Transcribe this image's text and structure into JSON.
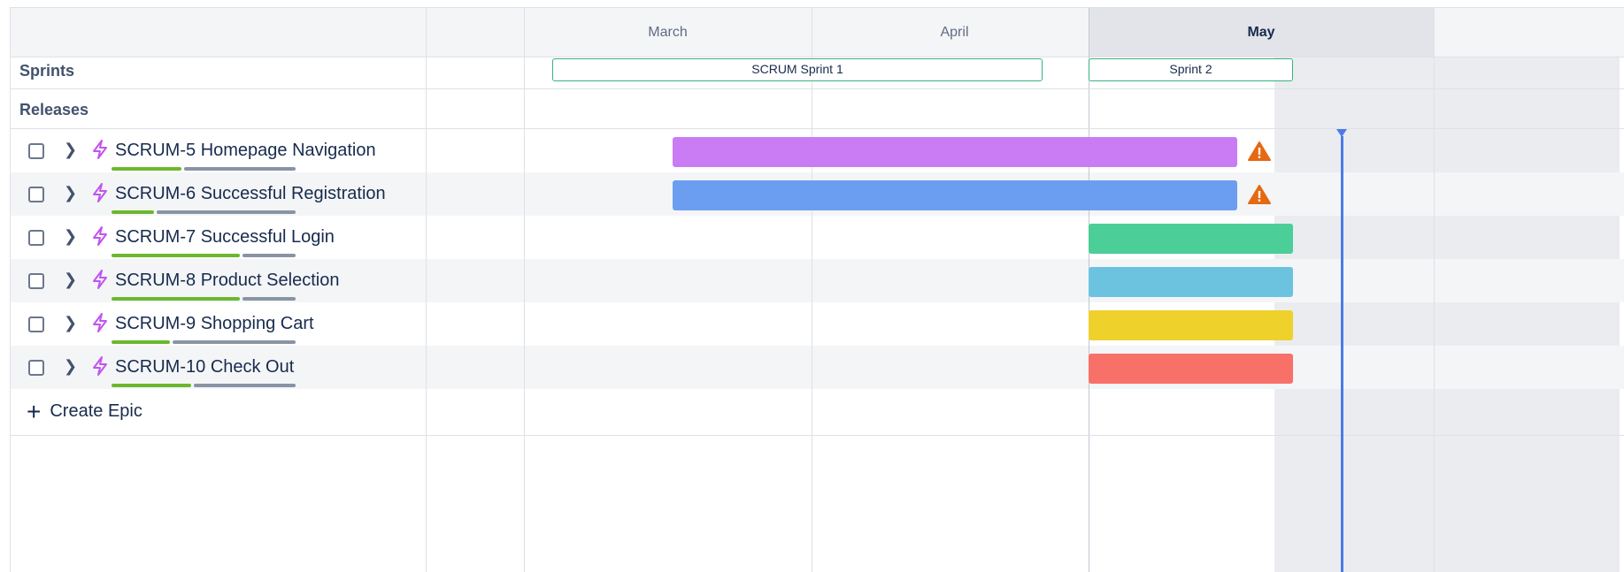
{
  "timeline": {
    "months": [
      {
        "label": "March",
        "current": false
      },
      {
        "label": "April",
        "current": false
      },
      {
        "label": "May",
        "current": true
      }
    ],
    "sections": {
      "sprints": "Sprints",
      "releases": "Releases"
    },
    "sprints": [
      {
        "label": "SCRUM Sprint 1",
        "color": "#36b37e"
      },
      {
        "label": "Sprint 2",
        "color": "#36b37e"
      }
    ],
    "epics": [
      {
        "key": "SCRUM-5",
        "title": "Homepage Navigation",
        "bar_color": "#c97cf4",
        "warning": true,
        "done_fraction": 0.38
      },
      {
        "key": "SCRUM-6",
        "title": "Successful Registration",
        "bar_color": "#6b9ef0",
        "warning": true,
        "done_fraction": 0.23
      },
      {
        "key": "SCRUM-7",
        "title": "Successful Login",
        "bar_color": "#4bce97",
        "warning": false,
        "done_fraction": 0.7
      },
      {
        "key": "SCRUM-8",
        "title": "Product Selection",
        "bar_color": "#6cc3e0",
        "warning": false,
        "done_fraction": 0.7
      },
      {
        "key": "SCRUM-9",
        "title": "Shopping Cart",
        "bar_color": "#eed12b",
        "warning": false,
        "done_fraction": 0.32
      },
      {
        "key": "SCRUM-10",
        "title": "Check Out",
        "bar_color": "#f87168",
        "warning": false,
        "done_fraction": 0.44
      }
    ],
    "create_epic_label": "Create Epic",
    "colors": {
      "accent_today": "#4c7be8",
      "warning": "#e56910",
      "progress_done": "#6bb82c",
      "progress_todo": "#8993a4"
    }
  }
}
